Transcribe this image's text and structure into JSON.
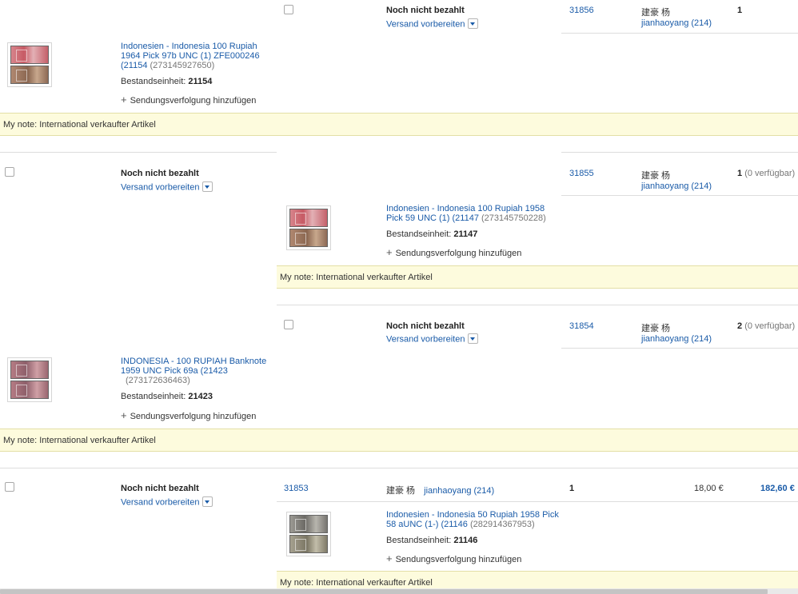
{
  "common": {
    "status": "Noch nicht bezahlt",
    "ship_action": "Versand vorbereiten",
    "sku_label": "Bestandseinheit:",
    "tracking": "Sendungsverfolgung hinzufügen",
    "note": "My note: International verkaufter Artikel",
    "buyer_name": "建豪 杨",
    "buyer_id": "jianhaoyang (214)"
  },
  "orders": [
    {
      "record": "31856",
      "qty": "1",
      "avail": "",
      "title": "Indonesien - Indonesia 100 Rupiah 1964 Pick 97b UNC (1) ZFE000246 (21154",
      "item_no": "(273145927650)",
      "sku": "21154"
    },
    {
      "record": "31855",
      "qty": "1",
      "avail": "(0 verfügbar)",
      "title": "Indonesien - Indonesia 100 Rupiah 1958 Pick 59 UNC (1) (21147",
      "item_no": "(273145750228)",
      "sku": "21147"
    },
    {
      "record": "31854",
      "qty": "2",
      "avail": "(0 verfügbar)",
      "title": "INDONESIA - 100 RUPIAH Banknote 1959 UNC Pick 69a (21423",
      "item_no": "(273172636463)",
      "sku": "21423"
    },
    {
      "record": "31853",
      "qty": "1",
      "avail": "",
      "price": "18,00 €",
      "total": "182,60 €",
      "title": "Indonesien - Indonesia 50 Rupiah 1958 Pick 58 aUNC (1-) (21146",
      "item_no": "(282914367953)",
      "sku": "21146"
    }
  ]
}
